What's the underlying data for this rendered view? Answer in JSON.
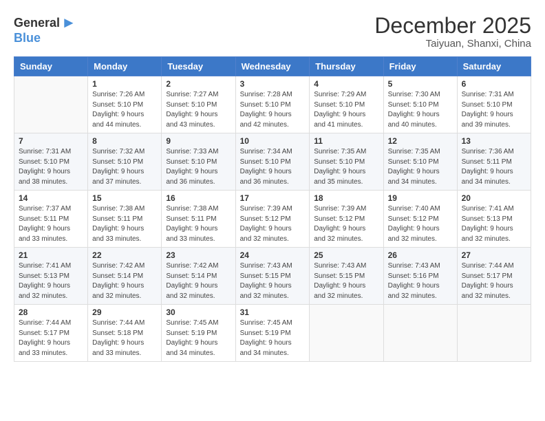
{
  "header": {
    "logo_general": "General",
    "logo_blue": "Blue",
    "month_year": "December 2025",
    "location": "Taiyuan, Shanxi, China"
  },
  "weekdays": [
    "Sunday",
    "Monday",
    "Tuesday",
    "Wednesday",
    "Thursday",
    "Friday",
    "Saturday"
  ],
  "weeks": [
    [
      {
        "day": "",
        "info": ""
      },
      {
        "day": "1",
        "info": "Sunrise: 7:26 AM\nSunset: 5:10 PM\nDaylight: 9 hours\nand 44 minutes."
      },
      {
        "day": "2",
        "info": "Sunrise: 7:27 AM\nSunset: 5:10 PM\nDaylight: 9 hours\nand 43 minutes."
      },
      {
        "day": "3",
        "info": "Sunrise: 7:28 AM\nSunset: 5:10 PM\nDaylight: 9 hours\nand 42 minutes."
      },
      {
        "day": "4",
        "info": "Sunrise: 7:29 AM\nSunset: 5:10 PM\nDaylight: 9 hours\nand 41 minutes."
      },
      {
        "day": "5",
        "info": "Sunrise: 7:30 AM\nSunset: 5:10 PM\nDaylight: 9 hours\nand 40 minutes."
      },
      {
        "day": "6",
        "info": "Sunrise: 7:31 AM\nSunset: 5:10 PM\nDaylight: 9 hours\nand 39 minutes."
      }
    ],
    [
      {
        "day": "7",
        "info": "Sunrise: 7:31 AM\nSunset: 5:10 PM\nDaylight: 9 hours\nand 38 minutes."
      },
      {
        "day": "8",
        "info": "Sunrise: 7:32 AM\nSunset: 5:10 PM\nDaylight: 9 hours\nand 37 minutes."
      },
      {
        "day": "9",
        "info": "Sunrise: 7:33 AM\nSunset: 5:10 PM\nDaylight: 9 hours\nand 36 minutes."
      },
      {
        "day": "10",
        "info": "Sunrise: 7:34 AM\nSunset: 5:10 PM\nDaylight: 9 hours\nand 36 minutes."
      },
      {
        "day": "11",
        "info": "Sunrise: 7:35 AM\nSunset: 5:10 PM\nDaylight: 9 hours\nand 35 minutes."
      },
      {
        "day": "12",
        "info": "Sunrise: 7:35 AM\nSunset: 5:10 PM\nDaylight: 9 hours\nand 34 minutes."
      },
      {
        "day": "13",
        "info": "Sunrise: 7:36 AM\nSunset: 5:11 PM\nDaylight: 9 hours\nand 34 minutes."
      }
    ],
    [
      {
        "day": "14",
        "info": "Sunrise: 7:37 AM\nSunset: 5:11 PM\nDaylight: 9 hours\nand 33 minutes."
      },
      {
        "day": "15",
        "info": "Sunrise: 7:38 AM\nSunset: 5:11 PM\nDaylight: 9 hours\nand 33 minutes."
      },
      {
        "day": "16",
        "info": "Sunrise: 7:38 AM\nSunset: 5:11 PM\nDaylight: 9 hours\nand 33 minutes."
      },
      {
        "day": "17",
        "info": "Sunrise: 7:39 AM\nSunset: 5:12 PM\nDaylight: 9 hours\nand 32 minutes."
      },
      {
        "day": "18",
        "info": "Sunrise: 7:39 AM\nSunset: 5:12 PM\nDaylight: 9 hours\nand 32 minutes."
      },
      {
        "day": "19",
        "info": "Sunrise: 7:40 AM\nSunset: 5:12 PM\nDaylight: 9 hours\nand 32 minutes."
      },
      {
        "day": "20",
        "info": "Sunrise: 7:41 AM\nSunset: 5:13 PM\nDaylight: 9 hours\nand 32 minutes."
      }
    ],
    [
      {
        "day": "21",
        "info": "Sunrise: 7:41 AM\nSunset: 5:13 PM\nDaylight: 9 hours\nand 32 minutes."
      },
      {
        "day": "22",
        "info": "Sunrise: 7:42 AM\nSunset: 5:14 PM\nDaylight: 9 hours\nand 32 minutes."
      },
      {
        "day": "23",
        "info": "Sunrise: 7:42 AM\nSunset: 5:14 PM\nDaylight: 9 hours\nand 32 minutes."
      },
      {
        "day": "24",
        "info": "Sunrise: 7:43 AM\nSunset: 5:15 PM\nDaylight: 9 hours\nand 32 minutes."
      },
      {
        "day": "25",
        "info": "Sunrise: 7:43 AM\nSunset: 5:15 PM\nDaylight: 9 hours\nand 32 minutes."
      },
      {
        "day": "26",
        "info": "Sunrise: 7:43 AM\nSunset: 5:16 PM\nDaylight: 9 hours\nand 32 minutes."
      },
      {
        "day": "27",
        "info": "Sunrise: 7:44 AM\nSunset: 5:17 PM\nDaylight: 9 hours\nand 32 minutes."
      }
    ],
    [
      {
        "day": "28",
        "info": "Sunrise: 7:44 AM\nSunset: 5:17 PM\nDaylight: 9 hours\nand 33 minutes."
      },
      {
        "day": "29",
        "info": "Sunrise: 7:44 AM\nSunset: 5:18 PM\nDaylight: 9 hours\nand 33 minutes."
      },
      {
        "day": "30",
        "info": "Sunrise: 7:45 AM\nSunset: 5:19 PM\nDaylight: 9 hours\nand 34 minutes."
      },
      {
        "day": "31",
        "info": "Sunrise: 7:45 AM\nSunset: 5:19 PM\nDaylight: 9 hours\nand 34 minutes."
      },
      {
        "day": "",
        "info": ""
      },
      {
        "day": "",
        "info": ""
      },
      {
        "day": "",
        "info": ""
      }
    ]
  ]
}
